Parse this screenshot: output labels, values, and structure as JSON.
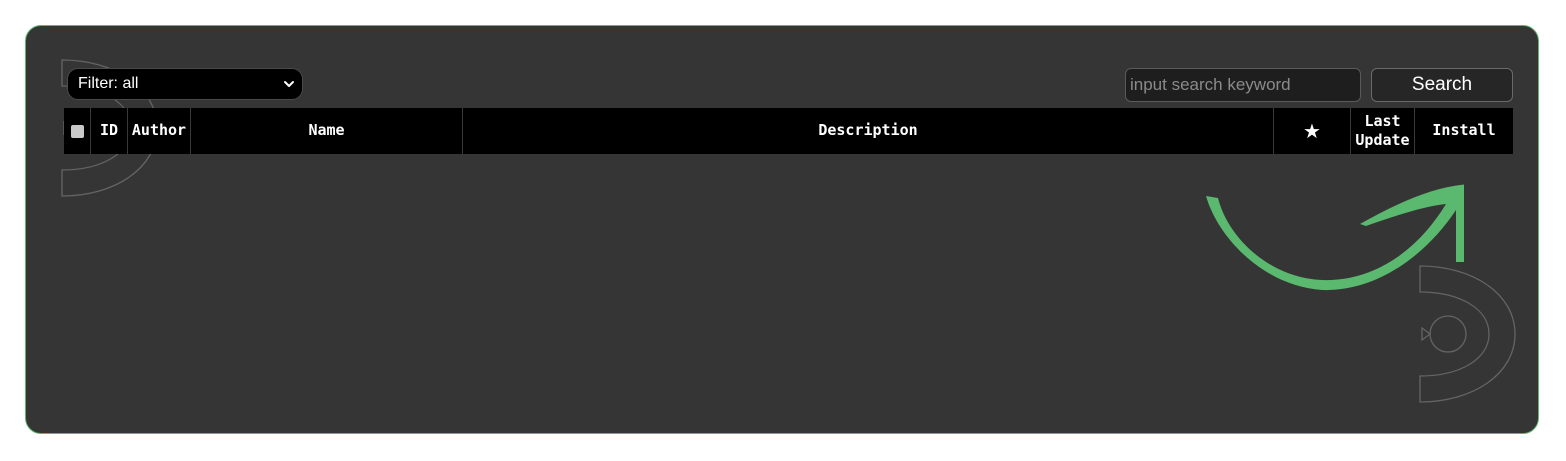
{
  "filter": {
    "selected": "Filter: all"
  },
  "search": {
    "placeholder": "input search keyword",
    "value": "",
    "button_label": "Search"
  },
  "table": {
    "columns": {
      "id": "ID",
      "author": "Author",
      "name": "Name",
      "description": "Description",
      "stars": "★",
      "last_update_line1": "Last",
      "last_update_line2": "Update",
      "install": "Install"
    },
    "rows": []
  },
  "colors": {
    "panel_background": "#353535",
    "panel_border": "#5bb86f",
    "header_background": "#000000",
    "accent_arrow": "#5bb86f"
  },
  "icons": {
    "watermark": "logo-watermark-icon",
    "arrow": "curved-arrow-icon",
    "dropdown": "chevron-down-icon"
  }
}
